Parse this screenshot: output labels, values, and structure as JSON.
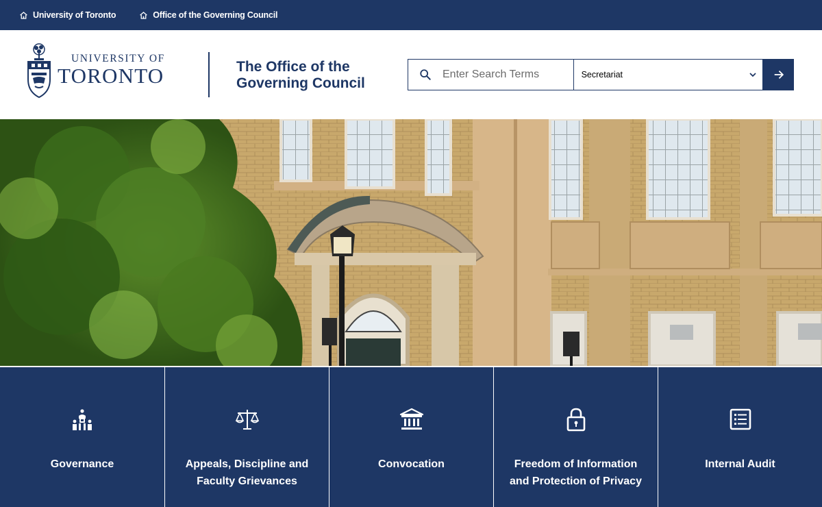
{
  "topbar": {
    "links": [
      {
        "label": "University of Toronto",
        "icon": "home-icon"
      },
      {
        "label": "Office of the Governing Council",
        "icon": "home-icon"
      }
    ]
  },
  "header": {
    "logo": {
      "line1": "UNIVERSITY OF",
      "line2": "TORONTO"
    },
    "site_title_line1": "The Office of the",
    "site_title_line2": "Governing Council"
  },
  "search": {
    "placeholder": "Enter Search Terms",
    "value": "",
    "scope_selected": "Secretariat",
    "icon": "search-icon",
    "submit_icon": "arrow-right-icon"
  },
  "tiles": [
    {
      "label": "Governance",
      "icon": "people-hierarchy-icon"
    },
    {
      "label": "Appeals, Discipline and Faculty Grievances",
      "icon": "scales-icon"
    },
    {
      "label": "Convocation",
      "icon": "institution-icon"
    },
    {
      "label": "Freedom of Information and Protection of Privacy",
      "icon": "lock-icon"
    },
    {
      "label": "Internal Audit",
      "icon": "list-document-icon"
    }
  ],
  "colors": {
    "brand": "#1e3765",
    "white": "#ffffff"
  }
}
